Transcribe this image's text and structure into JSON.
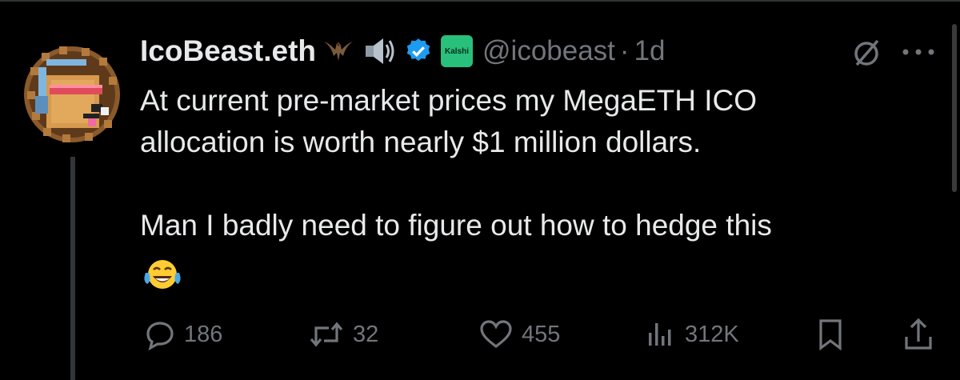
{
  "tweet": {
    "display_name": "IcoBeast.eth",
    "emojis": [
      "bat-emoji",
      "speaker-emoji"
    ],
    "badge_label": "Kalshi",
    "handle": "@icobeast",
    "separator": "·",
    "time": "1d",
    "text": "At current pre-market prices my MegaETH ICO\nallocation is worth nearly $1 million dollars.\n\nMan I badly need to figure out how to hedge this",
    "trailing_emoji": "laughing-tears-emoji"
  },
  "actions": {
    "replies": "186",
    "reposts": "32",
    "likes": "455",
    "views": "312K"
  },
  "colors": {
    "background": "#000000",
    "text": "#e7e9ea",
    "muted": "#71767b",
    "verified": "#1d9bf0",
    "kalshi": "#28c07a"
  }
}
